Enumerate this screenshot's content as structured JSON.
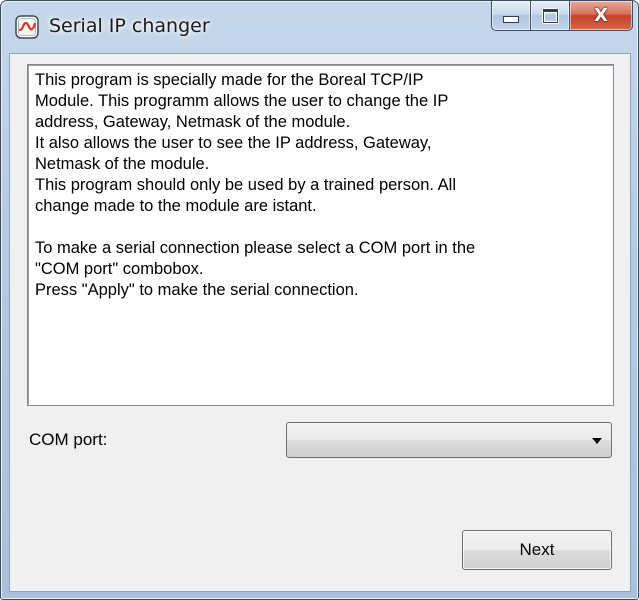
{
  "window": {
    "title": "Serial IP changer",
    "app_icon": "serial-port-icon",
    "minimize_icon": "minimize-icon",
    "maximize_icon": "maximize-icon",
    "close_icon": "close-icon",
    "close_glyph": "X"
  },
  "info": {
    "lines": [
      "This program is specially made for the Boreal TCP/IP",
      "Module. This programm allows the user to change the IP",
      "address, Gateway, Netmask of the module.",
      "It also allows the user to see the IP address, Gateway,",
      "Netmask of the module.",
      "This program should only be used by a trained person. All",
      "change made to the module are istant.",
      "",
      "To make a serial connection please select a COM port in the",
      "\"COM port\" combobox.",
      "Press \"Apply\" to make the serial connection."
    ]
  },
  "com_port": {
    "label": "COM port:",
    "selected": ""
  },
  "buttons": {
    "next_label": "Next"
  },
  "colors": {
    "title_glass": "#b5cbe2",
    "close_button": "#c2432b",
    "client_bg": "#f0f0f0",
    "app_icon_red": "#d9362a"
  }
}
